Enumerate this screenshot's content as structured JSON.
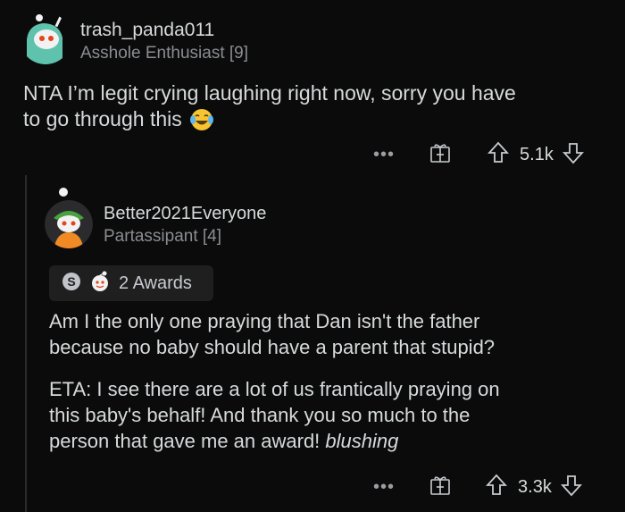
{
  "comment1": {
    "username": "trash_panda011",
    "flair": "Asshole Enthusiast [9]",
    "body": "NTA I'm legit crying laughing right now, sorry you have to go through this",
    "body_line1": "NTA I’m legit crying laughing right now, sorry you have",
    "body_line2": "to go through this",
    "emoji": "laughing-crying-emoji",
    "more": "•••",
    "score": "5.1k"
  },
  "comment2": {
    "username": "Better2021Everyone",
    "flair": "Partassipant [4]",
    "awards_label": "2 Awards",
    "para1_line1": "Am I the only one praying that Dan isn't the father",
    "para1_line2": "because no baby should have a parent that stupid?",
    "para2_line1": "ETA: I see there are a lot of us frantically praying on",
    "para2_line2": "this baby's behalf! And thank you so much to the",
    "para2_line3": "person that gave me an award!",
    "para2_italic": "blushing",
    "more": "•••",
    "score": "3.3k"
  },
  "colors": {
    "background": "#0b0b0b",
    "text": "#d7dadc",
    "muted": "#8a8d91",
    "pill": "#1f1f20"
  }
}
